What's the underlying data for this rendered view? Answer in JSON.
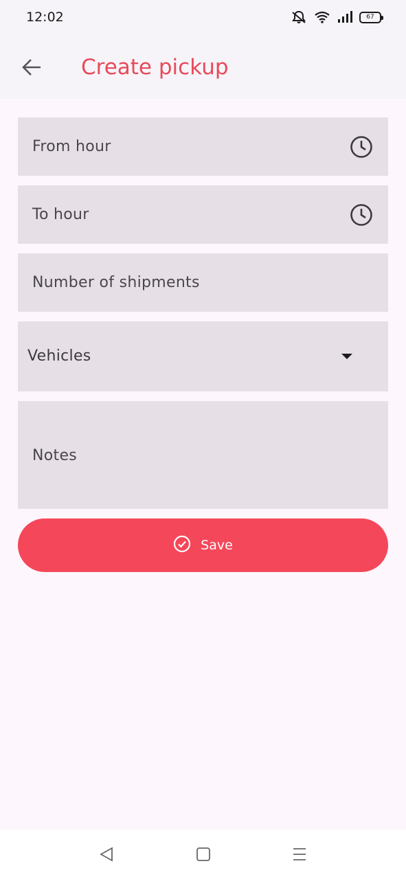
{
  "status_bar": {
    "time": "12:02",
    "battery": "67",
    "icons": [
      "mute-bell-icon",
      "wifi-icon",
      "signal-icon",
      "battery-icon"
    ]
  },
  "app_bar": {
    "title": "Create pickup",
    "back_icon": "arrow-left-icon"
  },
  "form": {
    "from_hour": "From hour",
    "to_hour": "To hour",
    "number_of_shipments": "Number of shipments",
    "vehicles": "Vehicles",
    "notes": "Notes"
  },
  "save_button": {
    "label": "Save",
    "icon": "check-circle-icon"
  },
  "colors": {
    "accent": "#e84a5a",
    "button": "#f5475a",
    "field_bg": "#e6e0e6",
    "page_bg": "#fdf6fc"
  },
  "nav_bar": {
    "icons": [
      "nav-back-icon",
      "nav-home-icon",
      "nav-menu-icon"
    ]
  }
}
